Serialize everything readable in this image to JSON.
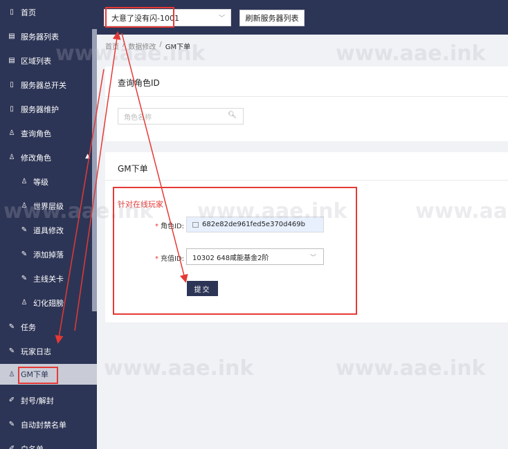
{
  "sidebar": {
    "items": [
      {
        "label": "首页",
        "icon": "page-icon"
      },
      {
        "label": "服务器列表",
        "icon": "list-icon"
      },
      {
        "label": "区域列表",
        "icon": "list-icon"
      },
      {
        "label": "服务器总开关",
        "icon": "page-icon"
      },
      {
        "label": "服务器维护",
        "icon": "page-icon"
      },
      {
        "label": "查询角色",
        "icon": "user-icon"
      },
      {
        "label": "修改角色",
        "icon": "user-icon"
      },
      {
        "label": "等级",
        "icon": "user-icon"
      },
      {
        "label": "世界层级",
        "icon": "user-icon"
      },
      {
        "label": "道具修改",
        "icon": "wrench-icon"
      },
      {
        "label": "添加掉落",
        "icon": "wrench-icon"
      },
      {
        "label": "主线关卡",
        "icon": "wrench-icon"
      },
      {
        "label": "幻化翅膀",
        "icon": "user-icon"
      },
      {
        "label": "任务",
        "icon": "wrench-icon"
      },
      {
        "label": "玩家日志",
        "icon": "wrench-icon"
      },
      {
        "label": "GM下单",
        "icon": "user-icon"
      },
      {
        "label": "封号/解封",
        "icon": "edit-icon"
      },
      {
        "label": "自动封禁名单",
        "icon": "wrench-icon"
      },
      {
        "label": "白名单",
        "icon": "edit-icon"
      }
    ]
  },
  "topbar": {
    "server_selected": "大意了没有闪-1001",
    "refresh_label": "刷新服务器列表"
  },
  "breadcrumb": {
    "home": "首页",
    "parent": "数据修改",
    "current": "GM下单",
    "sep": "/"
  },
  "query_panel": {
    "title": "查询角色ID",
    "search_placeholder": "角色名称"
  },
  "gm_panel": {
    "title": "GM下单",
    "section_label": "针对在线玩家",
    "role_id_label": "角色ID:",
    "role_id_value": "682e82de961fed5e370d469b",
    "recharge_label": "充值ID:",
    "recharge_value": "10302 648咸能基金2阶",
    "submit_label": "提交",
    "required_mark": "*"
  },
  "watermark": {
    "text": "www.aae.ink"
  },
  "colors": {
    "sidebar_bg": "#2d3556",
    "annotation_red": "#e53935",
    "active_item_bg": "#c9ccd6"
  }
}
